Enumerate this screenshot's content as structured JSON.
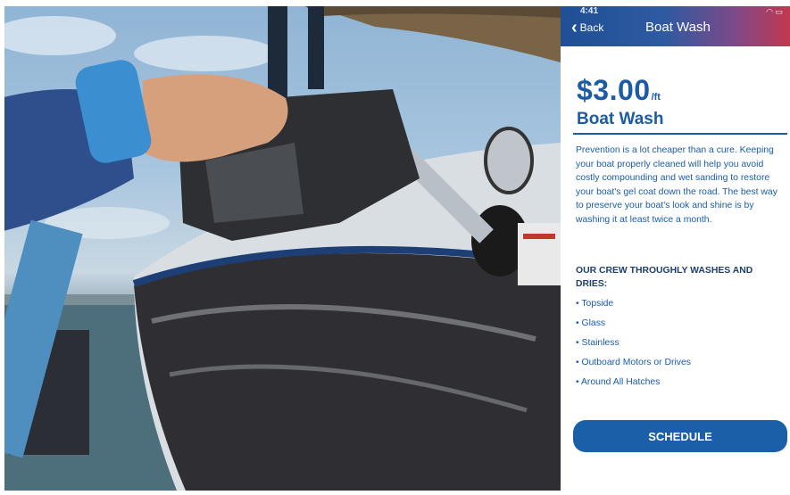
{
  "status_bar": {
    "time": "4:41",
    "icons": "wifi-icon battery-icon"
  },
  "nav": {
    "back_label": "Back",
    "title": "Boat Wash"
  },
  "service": {
    "price": "$3.00",
    "unit": "/ft",
    "name": "Boat Wash",
    "description": "Prevention is a lot cheaper than a cure. Keeping your boat properly cleaned will help you avoid costly compounding and wet sanding to restore your boat's gel coat down the road. The best way to preserve your boat's look and shine is by washing it at least twice a month.",
    "list_heading": "OUR CREW THROUGHLY WASHES AND DRIES:",
    "items": [
      "Topside",
      "Glass",
      "Stainless",
      "Outboard Motors or Drives",
      "Around All Hatches"
    ]
  },
  "cta": {
    "label": "SCHEDULE"
  },
  "colors": {
    "accent": "#1c5ca4",
    "button": "#1a5fa8",
    "gradient_start": "#1f4f95",
    "gradient_end": "#c2384f"
  }
}
